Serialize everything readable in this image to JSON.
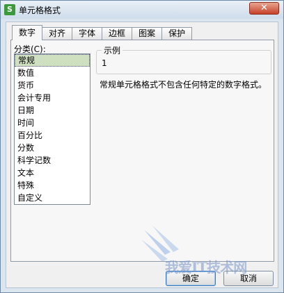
{
  "window": {
    "title": "单元格格式",
    "icon_letter": "S",
    "close_symbol": "✕"
  },
  "tabs": [
    {
      "label": "数字",
      "active": true
    },
    {
      "label": "对齐",
      "active": false
    },
    {
      "label": "字体",
      "active": false
    },
    {
      "label": "边框",
      "active": false
    },
    {
      "label": "图案",
      "active": false
    },
    {
      "label": "保护",
      "active": false
    }
  ],
  "category": {
    "label": "分类(C):",
    "items": [
      "常规",
      "数值",
      "货币",
      "会计专用",
      "日期",
      "时间",
      "百分比",
      "分数",
      "科学记数",
      "文本",
      "特殊",
      "自定义"
    ],
    "selected": "常规"
  },
  "sample": {
    "title": "示例",
    "value": "1"
  },
  "description": "常规单元格格式不包含任何特定的数字格式。",
  "buttons": {
    "ok": "确定",
    "cancel": "取消"
  },
  "watermark": {
    "text": "我爱IT技术网"
  },
  "colors": {
    "accent": "#3b7bbf",
    "selected_bg": "#cfe0c0",
    "close_red": "#c8412a",
    "app_icon_green": "#3c9a3c"
  }
}
